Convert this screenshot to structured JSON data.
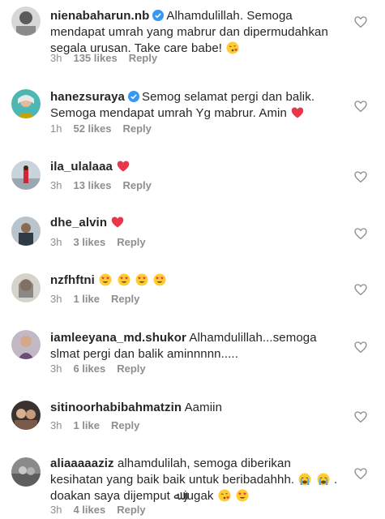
{
  "colors": {
    "text": "#262626",
    "muted": "#8e8e8e",
    "verified": "#3897f0",
    "heart_red": "#ed4956"
  },
  "comments": [
    {
      "username": "nienabaharun.nb",
      "verified": true,
      "text": "Alhamdulillah. Semoga mendapat umrah yang mabrur dan dipermudahkan segala urusan. Take care babe!",
      "time": "3h",
      "likes": "135 likes",
      "reply": "Reply",
      "emojis": [
        "kiss"
      ]
    },
    {
      "username": "hanezsuraya",
      "verified": true,
      "text": "Semog selamat pergi dan balik. Semoga mendapat umrah Yg mabrur. Amin",
      "time": "1h",
      "likes": "52 likes",
      "reply": "Reply",
      "emojis": [
        "red-heart"
      ]
    },
    {
      "username": "ila_ulalaaa",
      "verified": false,
      "text": "",
      "time": "3h",
      "likes": "13 likes",
      "reply": "Reply",
      "emojis": [
        "red-heart"
      ]
    },
    {
      "username": "dhe_alvin",
      "verified": false,
      "text": "",
      "time": "3h",
      "likes": "3 likes",
      "reply": "Reply",
      "emojis": [
        "red-heart"
      ]
    },
    {
      "username": "nzfhftni",
      "verified": false,
      "text": "",
      "time": "3h",
      "likes": "1 like",
      "reply": "Reply",
      "emojis": [
        "heart-eyes",
        "heart-eyes",
        "heart-eyes",
        "heart-eyes"
      ]
    },
    {
      "username": "iamleeyana_md.shukor",
      "verified": false,
      "text": "Alhamdulillah...semoga slmat pergi dan balik aminnnnn.....",
      "time": "3h",
      "likes": "6 likes",
      "reply": "Reply",
      "emojis": []
    },
    {
      "username": "sitinoorhabibahmatzin",
      "verified": false,
      "text": "Aamiin",
      "time": "3h",
      "likes": "1 like",
      "reply": "Reply",
      "emojis": []
    },
    {
      "username": "aliaaaaaziz",
      "verified": false,
      "text": "alhamdulilah, semoga diberikan kesihatan yang baik baik untuk beribadahhh.",
      "text2": ". doakan saya dijemput ﷲ jugak",
      "time": "3h",
      "likes": "4 likes",
      "reply": "Reply",
      "emojis": [
        "crying",
        "crying"
      ],
      "emojis2": [
        "kiss",
        "heart-eyes"
      ]
    }
  ]
}
